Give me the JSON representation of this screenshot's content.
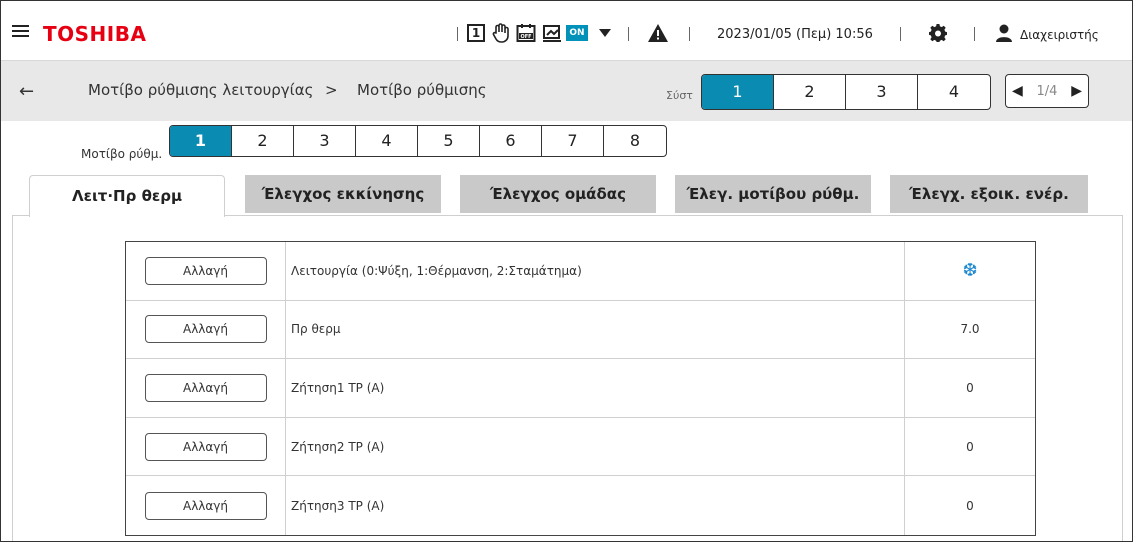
{
  "header": {
    "brand": "TOSHIBA",
    "icons": {
      "schedule_box": "1",
      "on_badge": "ON"
    },
    "datetime": "2023/01/05 (Πεμ) 10:56",
    "user": "Διαχειριστής"
  },
  "subheader": {
    "crumb_parent": "Μοτίβο ρύθμισης λειτουργίας",
    "crumb_sep": ">",
    "crumb_current": "Μοτίβο ρύθμισης",
    "system_label": "Σύστ",
    "system_tabs": [
      "1",
      "2",
      "3",
      "4"
    ],
    "system_active": 0,
    "page_indicator": "1/4"
  },
  "pattern": {
    "label": "Μοτίβο ρύθμ.",
    "tabs": [
      "1",
      "2",
      "3",
      "4",
      "5",
      "6",
      "7",
      "8"
    ],
    "active": 0
  },
  "function_tabs": [
    "Λειτ·Πρ θερμ",
    "Έλεγχος εκκίνησης",
    "Έλεγχος ομάδας",
    "Έλεγ. μοτίβου ρύθμ.",
    "Έλεγχ. εξοικ. ενέρ."
  ],
  "function_active": 0,
  "table": {
    "button_label": "Αλλαγή",
    "rows": [
      {
        "name": "Λειτουργία (0:Ψύξη, 1:Θέρμανση, 2:Σταμάτημα)",
        "value": "",
        "value_icon": "snowflake-icon"
      },
      {
        "name": "Πρ θερμ",
        "value": "7.0"
      },
      {
        "name": "Ζήτηση1 ΤΡ (Α)",
        "value": "0"
      },
      {
        "name": "Ζήτηση2 ΤΡ (Α)",
        "value": "0"
      },
      {
        "name": "Ζήτηση3 ΤΡ (Α)",
        "value": "0"
      }
    ]
  },
  "colors": {
    "brand": "#e60012",
    "accent": "#0a8bb2",
    "snow": "#1e88d0"
  }
}
